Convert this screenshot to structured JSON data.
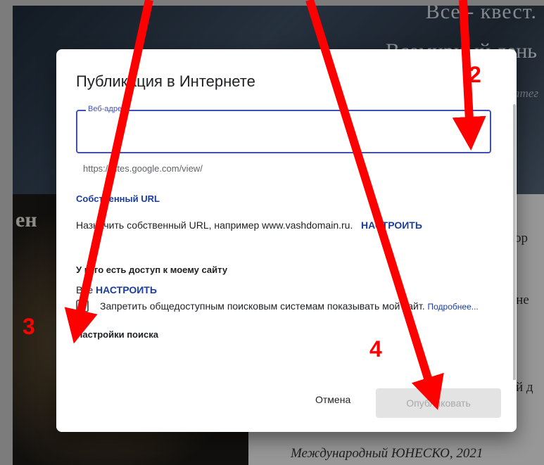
{
  "background": {
    "header_line1": "Все - квест.",
    "header_line2": "Всемирный день",
    "header_line3": "атег",
    "left_text": "ен",
    "right_line1": "тор",
    "right_line2": "ине",
    "right_line3": "й д",
    "right_line4": "Международный ЮНЕСКО, 2021"
  },
  "dialog": {
    "title": "Публикация в Интернете",
    "web_address_label": "Веб-адрес",
    "web_address_value": "",
    "url_hint": "https://sites.google.com/view/",
    "custom_url_title": "Собственный URL",
    "custom_url_text": "Назначить собственный URL, например www.vashdomain.ru.",
    "custom_url_link": "НАСТРОИТЬ",
    "access_title": "У кого есть доступ к моему сайту",
    "access_value": "Все",
    "access_link": "НАСТРОИТЬ",
    "search_title": "Настройки поиска",
    "search_checkbox_text": "Запретить общедоступным поисковым системам показывать мой сайт.",
    "search_more_link": "Подробнее...",
    "search_checked": false,
    "cancel_label": "Отмена",
    "publish_label": "Опубликовать"
  },
  "annotations": {
    "label2": "2",
    "label3": "3",
    "label4": "4",
    "color": "#ff0000"
  }
}
